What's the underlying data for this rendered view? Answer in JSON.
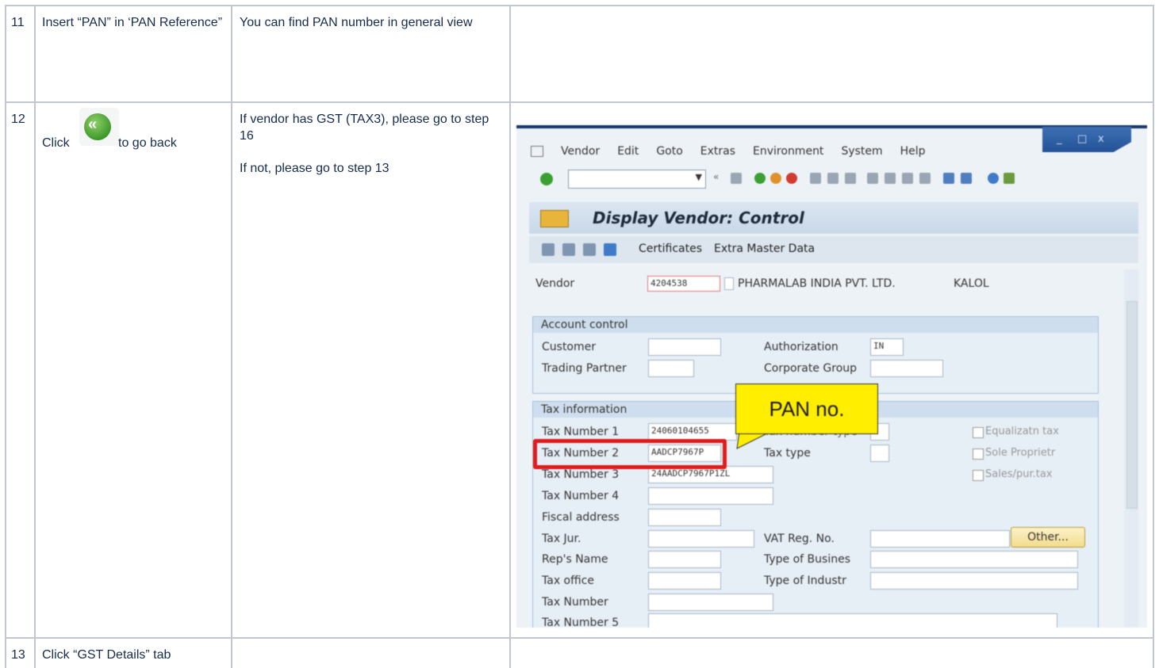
{
  "rows": [
    {
      "num": "11",
      "instruction": "Insert “PAN” in ‘PAN Reference”",
      "note": "You can find PAN number in general view"
    },
    {
      "num": "12",
      "instruction_prefix": "Click",
      "instruction_suffix": "to go back",
      "note_line1": "If vendor has GST (TAX3), please go to step 16",
      "note_line2": "If not, please go to step 13"
    },
    {
      "num": "13",
      "instruction": "Click “GST Details” tab"
    }
  ],
  "sap": {
    "menu": [
      "Vendor",
      "Edit",
      "Goto",
      "Extras",
      "Environment",
      "System",
      "Help"
    ],
    "window_controls": [
      "_",
      "□",
      "x"
    ],
    "title": "Display Vendor: Control",
    "app_toolbar": [
      "Certificates",
      "Extra Master Data"
    ],
    "vendor_label": "Vendor",
    "vendor_number": "4204538",
    "vendor_name": "PHARMALAB INDIA PVT. LTD.",
    "vendor_city": "KALOL",
    "account_control": {
      "header": "Account control",
      "customer": "Customer",
      "authorization": "Authorization",
      "authorization_value": "IN",
      "trading_partner": "Trading Partner",
      "corporate_group": "Corporate Group"
    },
    "tax_info": {
      "header": "Tax information",
      "tax_number_1": "Tax Number 1",
      "tax_number_1_value": "24060104655",
      "tax_number_type": "Tax number type",
      "tax_number_2": "Tax Number 2",
      "tax_number_2_value": "AADCP7967P",
      "tax_type": "Tax type",
      "tax_number_3": "Tax Number 3",
      "tax_number_3_value": "24AADCP7967P1ZL",
      "tax_number_4": "Tax Number 4",
      "fiscal_address": "Fiscal address",
      "tax_jur": "Tax Jur.",
      "vat_reg_no": "VAT Reg. No.",
      "other_button": "Other...",
      "reps_name": "Rep's Name",
      "type_of_business": "Type of Busines",
      "tax_office": "Tax office",
      "type_of_industry": "Type of Industr",
      "tax_number": "Tax Number",
      "tax_number_5": "Tax Number 5",
      "equalization_tax": "Equalizatn tax",
      "sole_proprietor": "Sole Proprietr",
      "sales_pur_tax": "Sales/pur.tax"
    },
    "callout": "PAN no."
  },
  "colors": {
    "highlight": "#e01b1b",
    "callout": "#ffee00",
    "border": "#c1c7d0"
  }
}
